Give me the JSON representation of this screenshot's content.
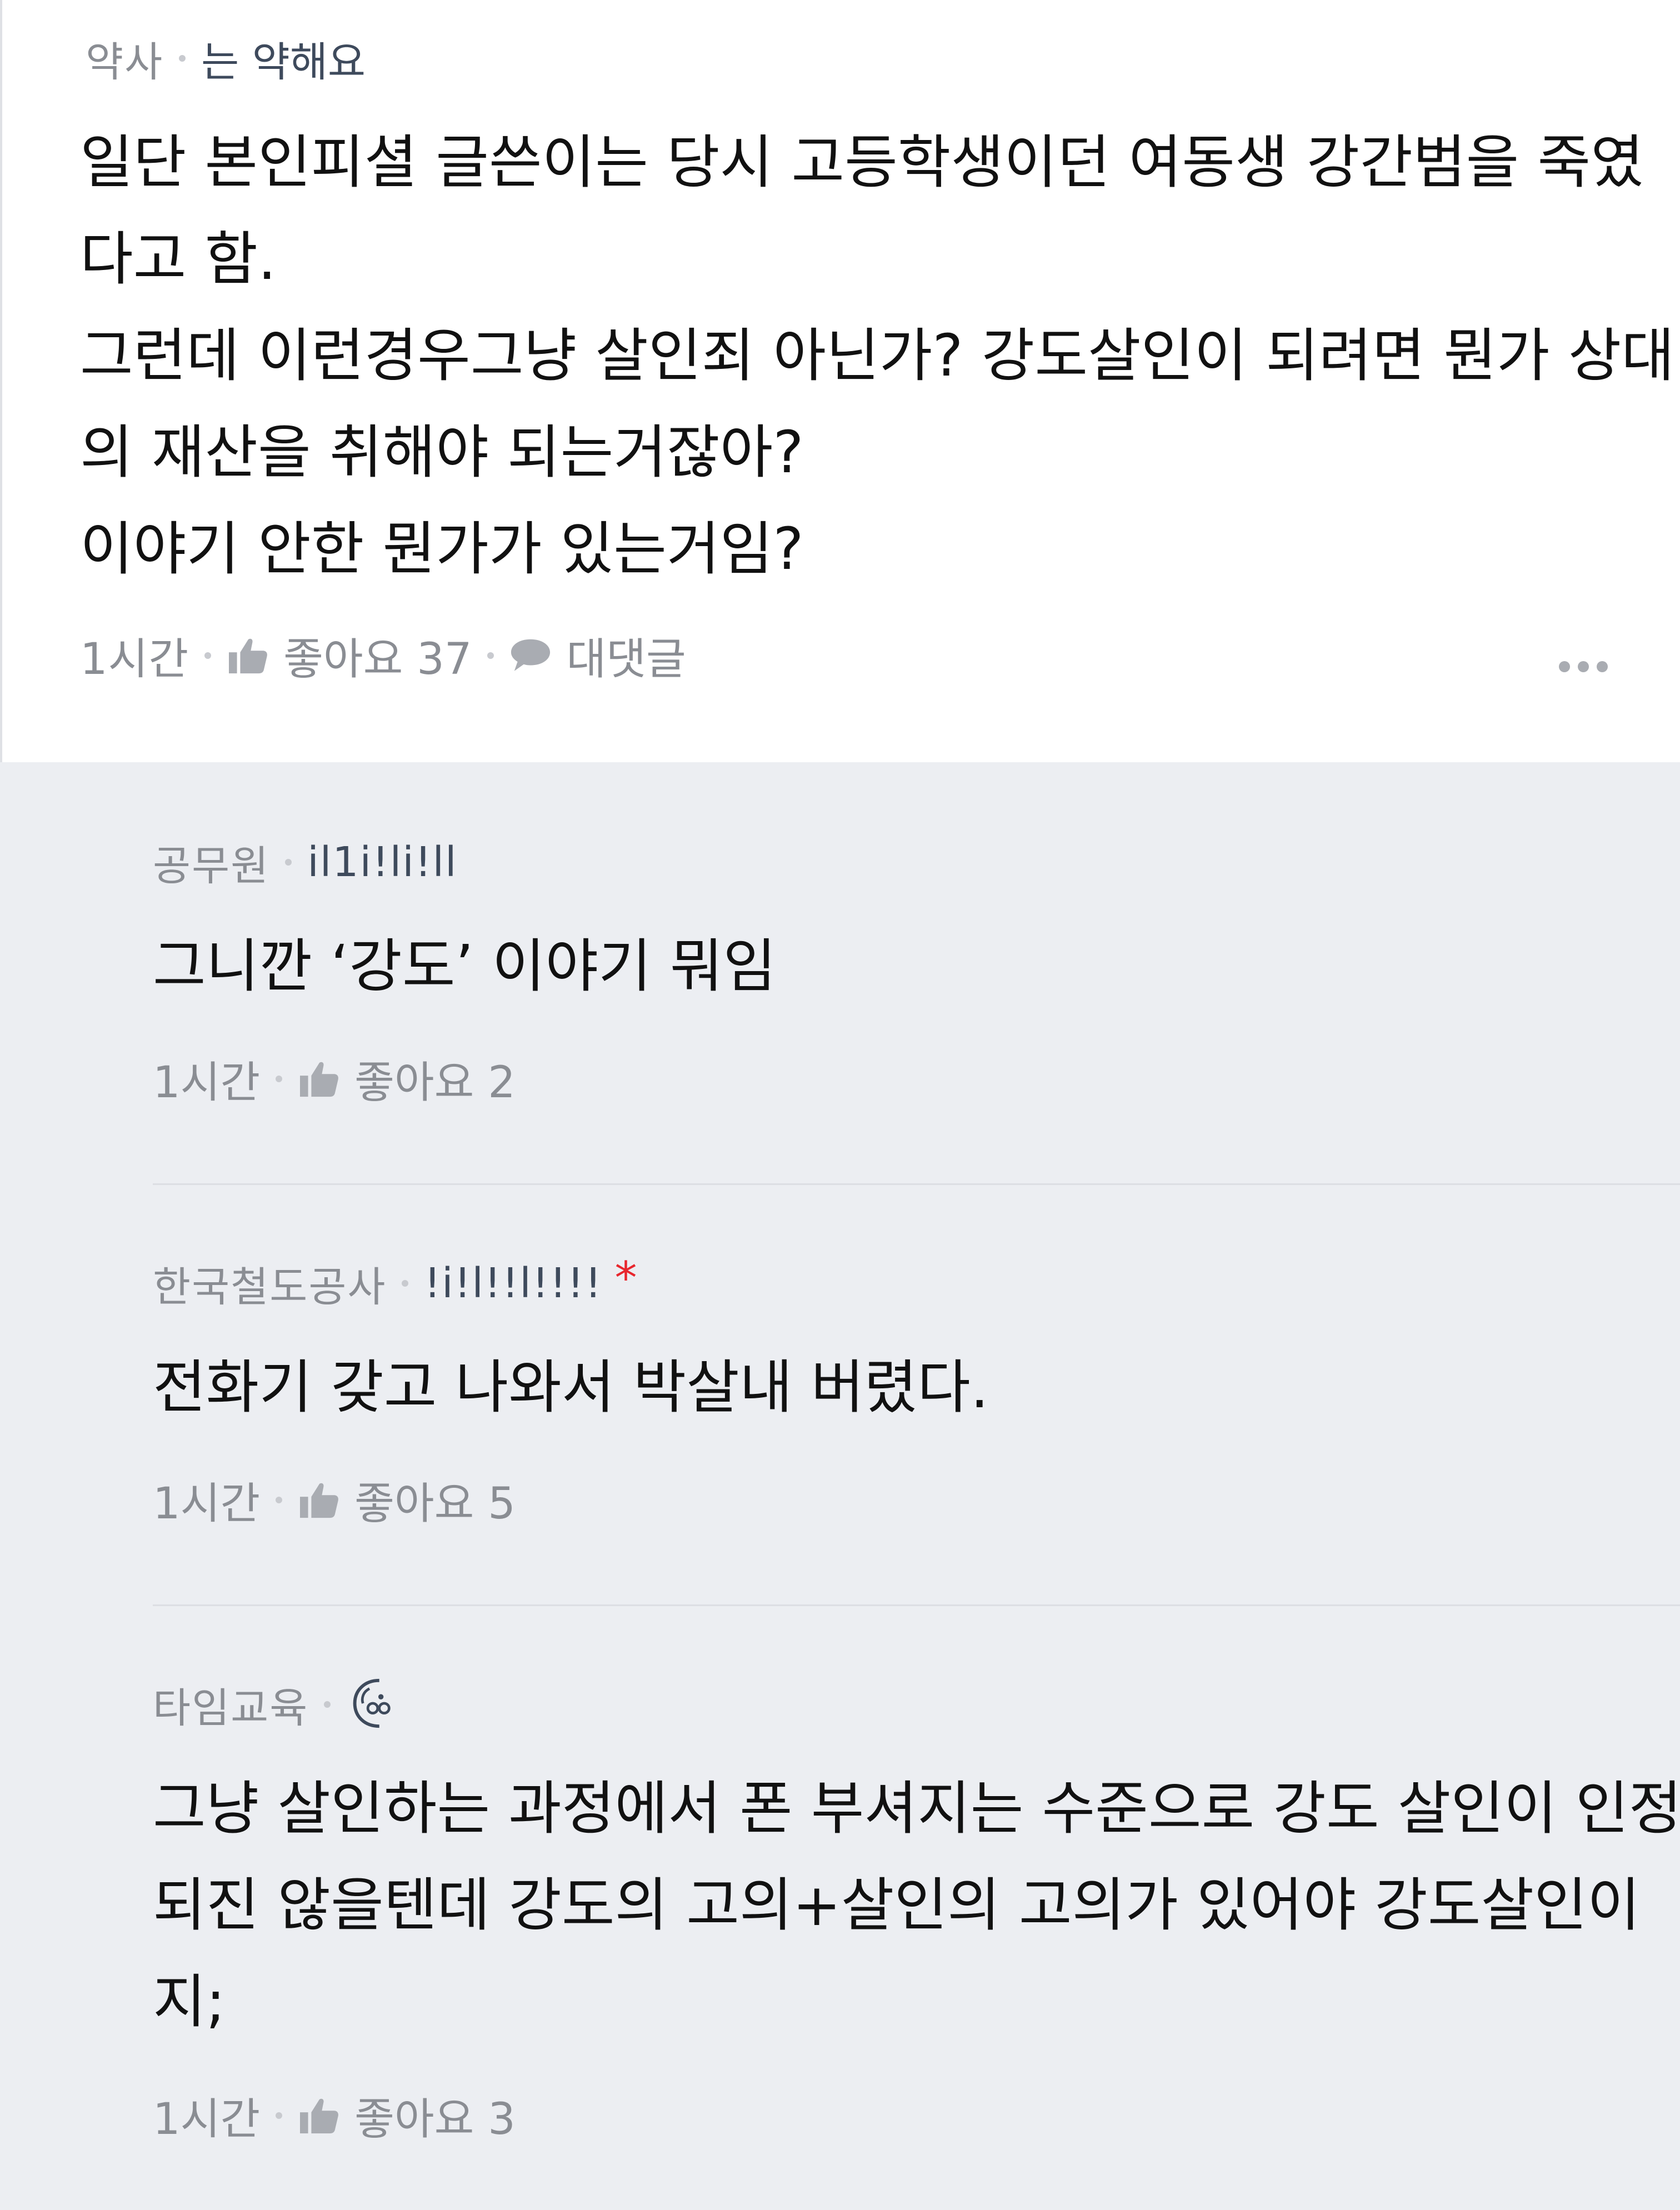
{
  "main_comment": {
    "company": "약사",
    "nickname": "는 약해요",
    "body_lines": [
      "일단 본인피셜 글쓴이는 당시 고등학생이던 여동생 강간범을 죽였",
      "다고 함.",
      "그런데 이런경우그냥 살인죄 아닌가? 강도살인이 되려면 뭔가 상대",
      "의 재산을 취해야 되는거잖아?",
      "이야기 안한 뭔가가 있는거임?"
    ],
    "time": "1시간",
    "like_label": "좋아요 37",
    "reply_label": "대댓글",
    "icons": {
      "like": "thumbs-up-icon",
      "reply": "speech-bubble-icon",
      "more": "more-dots-icon"
    }
  },
  "replies": [
    {
      "company": "공무원",
      "nickname": "il1i!li!ll",
      "body_lines": [
        "그니깐 ‘강도’ 이야기 뭐임"
      ],
      "time": "1시간",
      "like_label": "좋아요 2"
    },
    {
      "company": "한국철도공사",
      "nickname": "!i!l!!l!!!!",
      "badge": "*",
      "body_lines": [
        "전화기 갖고 나와서 박살내 버렸다."
      ],
      "time": "1시간",
      "like_label": "좋아요 5"
    },
    {
      "company": "타임교육",
      "nickname_icon": "face-doodle-icon",
      "body_lines": [
        "그냥 살인하는 과정에서 폰 부셔지는 수준으로 강도 살인이 인정",
        "되진 않을텐데 강도의 고의+살인의 고의가 있어야 강도살인이",
        "지;"
      ],
      "time": "1시간",
      "like_label": "좋아요 3"
    }
  ],
  "colors": {
    "background_main": "#ffffff",
    "background_replies": "#eceef2",
    "meta_text": "#8a8d93",
    "nickname_text": "#3e4a5c",
    "body_text": "#111111",
    "badge_red": "#e8262d"
  }
}
